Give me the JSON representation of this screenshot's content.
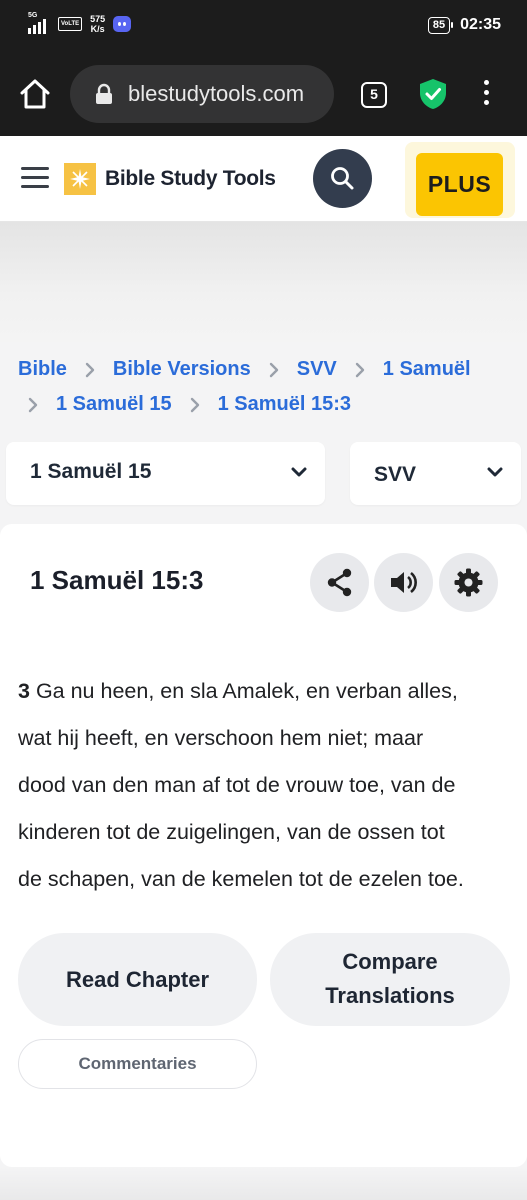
{
  "status_bar": {
    "network": "5G",
    "volte": "VoLTE",
    "speed_value": "575",
    "speed_unit": "K/s",
    "battery": "85",
    "time": "02:35"
  },
  "browser": {
    "url": "blestudytools.com",
    "tab_count": "5"
  },
  "site_header": {
    "logo_text": "Bible Study Tools",
    "plus_label": "PLUS"
  },
  "breadcrumb": {
    "items": [
      "Bible",
      "Bible Versions",
      "SVV",
      "1 Samuël",
      "1 Samuël 15",
      "1 Samuël 15:3"
    ]
  },
  "selectors": {
    "chapter": "1 Samuël 15",
    "version": "SVV"
  },
  "verse": {
    "title": "1 Samuël 15:3",
    "number": "3",
    "lines": [
      " Ga nu heen, en sla Amalek, en verban alles,",
      "wat hij heeft, en verschoon hem niet; maar",
      "dood van den man af tot de vrouw toe, van de",
      "kinderen tot de zuigelingen, van de ossen tot",
      "de schapen, van de kemelen tot de ezelen toe."
    ]
  },
  "actions": {
    "read_chapter": "Read Chapter",
    "compare_line1": "Compare",
    "compare_line2": "Translations",
    "commentaries": "Commentaries"
  },
  "colors": {
    "link_blue": "#2b6cd9",
    "plus_yellow": "#fbc502",
    "search_navy": "#333d4e",
    "browser_dark": "#1c1c1c",
    "shield_green": "#16c36a"
  }
}
